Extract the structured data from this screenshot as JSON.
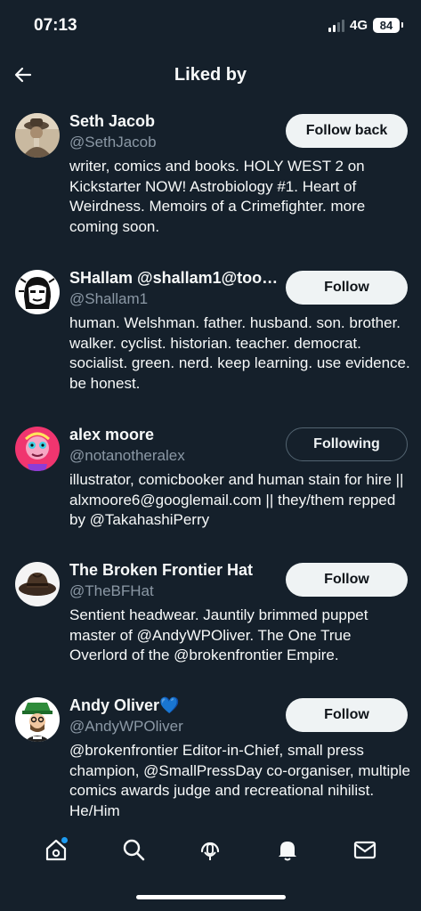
{
  "status": {
    "time": "07:13",
    "network": "4G",
    "battery": "84"
  },
  "header": {
    "title": "Liked by"
  },
  "colors": {
    "background": "#15202b",
    "text": "#f7f9f9",
    "muted": "#8b98a5",
    "accent": "#1d9bf0"
  },
  "users": [
    {
      "name": "Seth Jacob",
      "handle": "@SethJacob",
      "bio": "writer, comics and books. HOLY WEST 2 on Kickstarter NOW! Astrobiology #1. Heart of Weirdness. Memoirs of a Crimefighter. more coming soon.",
      "button": "Follow back",
      "avatar_icon": "sepia-portrait"
    },
    {
      "name": "SHallam @shallam1@toot....",
      "handle": "@Shallam1",
      "bio": "human. Welshman. father. husband. son. brother. walker. cyclist. historian. teacher. democrat. socialist. green. nerd. keep learning. use evidence. be honest.",
      "button": "Follow",
      "avatar_icon": "comic-face"
    },
    {
      "name": "alex moore",
      "handle": "@notanotheralex",
      "bio": "illustrator, comicbooker and human stain for hire || alxmoore6@googlemail.com || they/them repped by @TakahashiPerry",
      "button": "Following",
      "avatar_icon": "pink-illustrated-face"
    },
    {
      "name": "The Broken Frontier Hat",
      "handle": "@TheBFHat",
      "bio": "Sentient headwear. Jauntily brimmed puppet master of @AndyWPOliver. The One True Overlord of the @brokenfrontier Empire.",
      "button": "Follow",
      "avatar_icon": "fedora-hat"
    },
    {
      "name": "Andy Oliver",
      "name_emoji": "💙",
      "handle": "@AndyWPOliver",
      "bio": "@brokenfrontier Editor-in-Chief, small press champion, @SmallPressDay co-organiser, multiple comics awards judge and recreational nihilist. He/Him",
      "button": "Follow",
      "avatar_icon": "cartoon-man-hat"
    }
  ],
  "tabbar": [
    "home-icon",
    "search-icon",
    "spaces-icon",
    "notifications-icon",
    "messages-icon"
  ]
}
